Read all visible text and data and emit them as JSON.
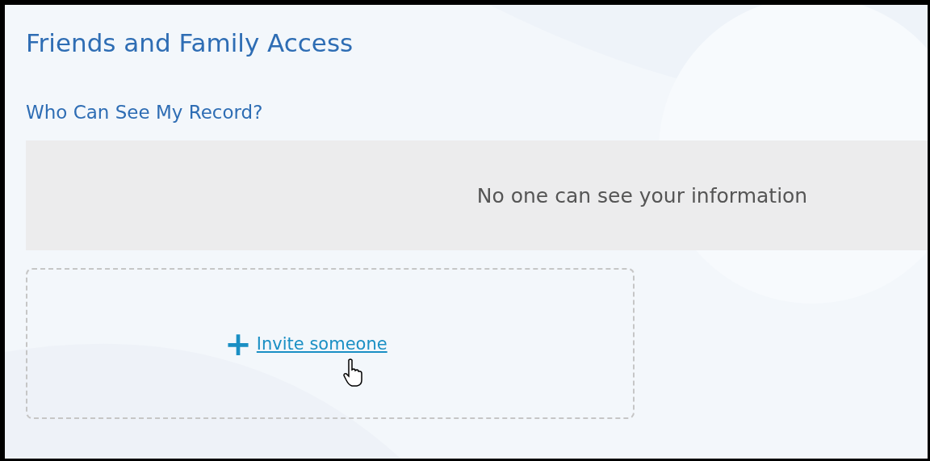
{
  "page": {
    "title": "Friends and Family Access",
    "section_title": "Who Can See My Record?"
  },
  "access_list": {
    "empty_message": "No one can see your information"
  },
  "invite": {
    "icon": "+",
    "link": "Invite someone"
  }
}
